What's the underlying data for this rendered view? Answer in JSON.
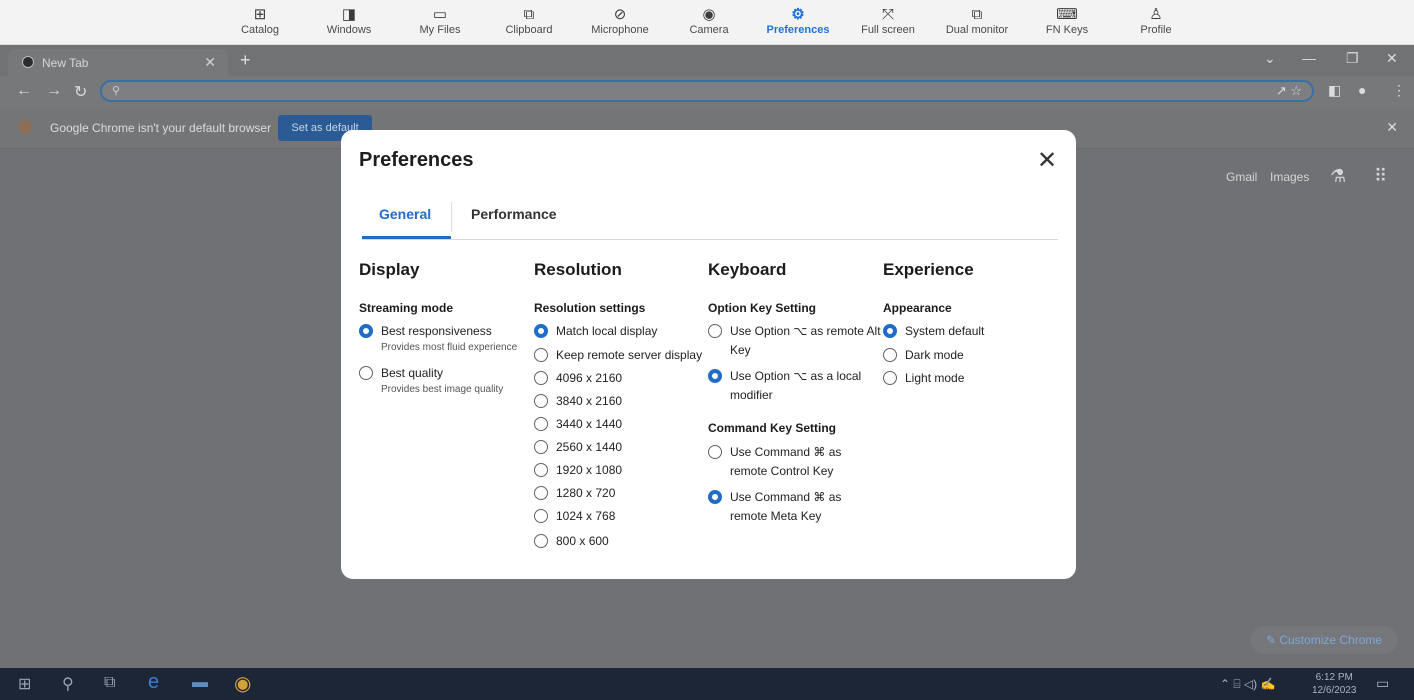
{
  "toolbar": {
    "items": [
      {
        "label": "Catalog",
        "icon": "plus-square-icon"
      },
      {
        "label": "Windows",
        "icon": "window-icon"
      },
      {
        "label": "My Files",
        "icon": "folder-icon"
      },
      {
        "label": "Clipboard",
        "icon": "clipboard-icon"
      },
      {
        "label": "Microphone",
        "icon": "microphone-off-icon"
      },
      {
        "label": "Camera",
        "icon": "camera-icon"
      },
      {
        "label": "Preferences",
        "icon": "gear-icon"
      },
      {
        "label": "Full screen",
        "icon": "fullscreen-icon"
      },
      {
        "label": "Dual monitor",
        "icon": "dual-monitor-icon"
      },
      {
        "label": "FN Keys",
        "icon": "keyboard-icon"
      },
      {
        "label": "Profile",
        "icon": "person-icon"
      }
    ],
    "active": "Preferences"
  },
  "browser": {
    "tab_title": "New Tab",
    "infobar_message": "Google Chrome isn't your default browser",
    "infobar_button": "Set as default",
    "ntp_links": [
      "Gmail",
      "Images"
    ],
    "customize_button": "Customize Chrome"
  },
  "taskbar": {
    "time": "6:12 PM",
    "date": "12/6/2023"
  },
  "modal": {
    "title": "Preferences",
    "tabs": [
      "General",
      "Performance"
    ],
    "active_tab": "General",
    "columns": {
      "display": {
        "heading": "Display",
        "section": "Streaming mode",
        "options": [
          {
            "label": "Best responsiveness",
            "desc": "Provides most fluid experience",
            "selected": true
          },
          {
            "label": "Best quality",
            "desc": "Provides best image quality",
            "selected": false
          }
        ]
      },
      "resolution": {
        "heading": "Resolution",
        "section": "Resolution settings",
        "options": [
          {
            "label": "Match local display",
            "selected": true
          },
          {
            "label": "Keep remote server display",
            "selected": false
          },
          {
            "label": "4096 x 2160",
            "selected": false
          },
          {
            "label": "3840 x 2160",
            "selected": false
          },
          {
            "label": "3440 x 1440",
            "selected": false
          },
          {
            "label": "2560 x 1440",
            "selected": false
          },
          {
            "label": "1920 x 1080",
            "selected": false
          },
          {
            "label": "1280 x 720",
            "selected": false
          },
          {
            "label": "1024 x 768",
            "selected": false
          },
          {
            "label": "800 x 600",
            "selected": false
          }
        ]
      },
      "keyboard": {
        "heading": "Keyboard",
        "option_section": "Option Key Setting",
        "option_options": [
          {
            "label": "Use Option ⌥ as remote Alt Key",
            "selected": false
          },
          {
            "label": "Use Option ⌥ as a local modifier",
            "selected": true
          }
        ],
        "command_section": "Command Key Setting",
        "command_options": [
          {
            "label": "Use Command ⌘ as remote Control Key",
            "selected": false
          },
          {
            "label": "Use Command ⌘ as remote Meta Key",
            "selected": true
          }
        ]
      },
      "experience": {
        "heading": "Experience",
        "section": "Appearance",
        "options": [
          {
            "label": "System default",
            "selected": true
          },
          {
            "label": "Dark mode",
            "selected": false
          },
          {
            "label": "Light mode",
            "selected": false
          }
        ]
      }
    }
  },
  "colors": {
    "accent": "#1f6cc9",
    "overlay": "#6f7174",
    "taskbar": "#1d2636"
  }
}
